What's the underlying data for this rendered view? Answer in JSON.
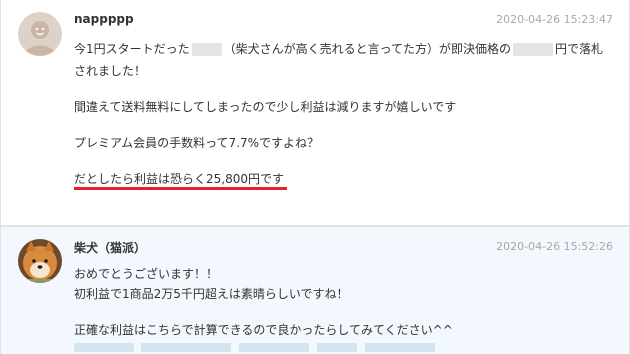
{
  "comments": [
    {
      "username": "nappppp",
      "timestamp": "2020-04-26 15:23:47",
      "avatar": "default-user-avatar-icon",
      "lines": [
        "今1円スタートだった",
        "（柴犬さんが高く売れると言ってた方）が即決価格の",
        "円で落札",
        "されました！",
        "間違えて送料無料にしてしまったので少し利益は減りますが嬉しいです",
        "プレミアム会員の手数料って7.7%ですよね？",
        "だとしたら利益は恐らく25,800円です"
      ]
    },
    {
      "username": "柴犬（猫派）",
      "timestamp": "2020-04-26 15:52:26",
      "avatar": "shiba-dog-avatar-icon",
      "lines": [
        "おめでとうございます！！",
        "初利益で1商品2万5千円超えは素晴らしいですね！",
        "正確な利益はこちらで計算できるので良かったらしてみてください^^"
      ]
    }
  ],
  "colors": {
    "underline": "#e8202a",
    "reply_background": "#f2f8fd",
    "timestamp": "#a8a8a8"
  }
}
